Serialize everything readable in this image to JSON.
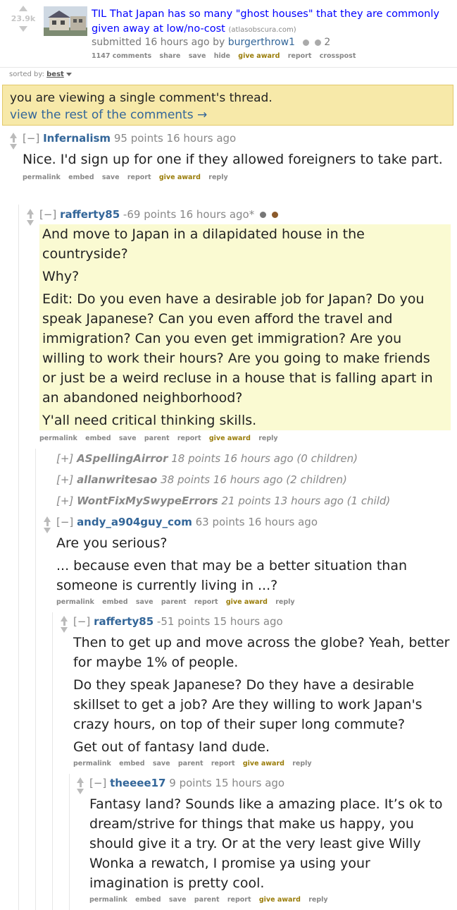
{
  "post": {
    "score": "23.9k",
    "title": "TIL That Japan has so many \"ghost houses\" that they are commonly given away at low/no-cost",
    "domain": "(atlasobscura.com)",
    "submitted": "submitted 16 hours ago by",
    "author": "burgerthrow1",
    "award_count": "2",
    "buttons": [
      "1147 comments",
      "share",
      "save",
      "hide",
      "give award",
      "report",
      "crosspost"
    ]
  },
  "sort": {
    "label": "sorted by:",
    "value": "best"
  },
  "notice": {
    "line1": "you are viewing a single comment's thread.",
    "line2": "view the rest of the comments →"
  },
  "comments": [
    {
      "toggle": "[−]",
      "author": "Infernalism",
      "meta": "95 points 16 hours ago",
      "paras": [
        "Nice. I'd sign up for one if they allowed foreigners to take part."
      ],
      "buttons": [
        "permalink",
        "embed",
        "save",
        "report",
        "give award",
        "reply"
      ]
    },
    {
      "toggle": "[−]",
      "author": "rafferty85",
      "meta": "-69 points 16 hours ago*",
      "paras": [
        "And move to Japan in a dilapidated house in the countryside?",
        "Why?",
        "Edit: Do you even have a desirable job for Japan? Do you speak Japanese? Can you even afford the travel and immigration? Can you even get immigration? Are you willing to work their hours? Are you going to make friends or just be a weird recluse in a house that is falling apart in an abandoned neighborhood?",
        "Y'all need critical thinking skills."
      ],
      "buttons": [
        "permalink",
        "embed",
        "save",
        "parent",
        "report",
        "give award",
        "reply"
      ]
    },
    {
      "toggle": "[+]",
      "author": "ASpellingAirror",
      "meta": "18 points 16 hours ago (0 children)"
    },
    {
      "toggle": "[+]",
      "author": "allanwritesao",
      "meta": "38 points 16 hours ago (2 children)"
    },
    {
      "toggle": "[+]",
      "author": "WontFixMySwypeErrors",
      "meta": "21 points 13 hours ago (1 child)"
    },
    {
      "toggle": "[−]",
      "author": "andy_a904guy_com",
      "meta": "63 points 16 hours ago",
      "paras": [
        "Are you serious?",
        "... because even that may be a better situation than someone is currently living in ...?"
      ],
      "buttons": [
        "permalink",
        "embed",
        "save",
        "parent",
        "report",
        "give award",
        "reply"
      ]
    },
    {
      "toggle": "[−]",
      "author": "rafferty85",
      "meta": "-51 points 15 hours ago",
      "paras": [
        "Then to get up and move across the globe? Yeah, better for maybe 1% of people.",
        "Do they speak Japanese? Do they have a desirable skillset to get a job? Are they willing to work Japan's crazy hours, on top of their super long commute?",
        "Get out of fantasy land dude."
      ],
      "buttons": [
        "permalink",
        "embed",
        "save",
        "parent",
        "report",
        "give award",
        "reply"
      ]
    },
    {
      "toggle": "[−]",
      "author": "theeee17",
      "meta": "9 points 15 hours ago",
      "paras": [
        "Fantasy land? Sounds like a amazing place. It’s ok to dream/strive for things that make us happy, you should give it a try. Or at the very least give Willy Wonka a rewatch, I promise ya using your imagination is pretty cool."
      ],
      "buttons": [
        "permalink",
        "embed",
        "save",
        "parent",
        "report",
        "give award",
        "reply"
      ]
    }
  ]
}
